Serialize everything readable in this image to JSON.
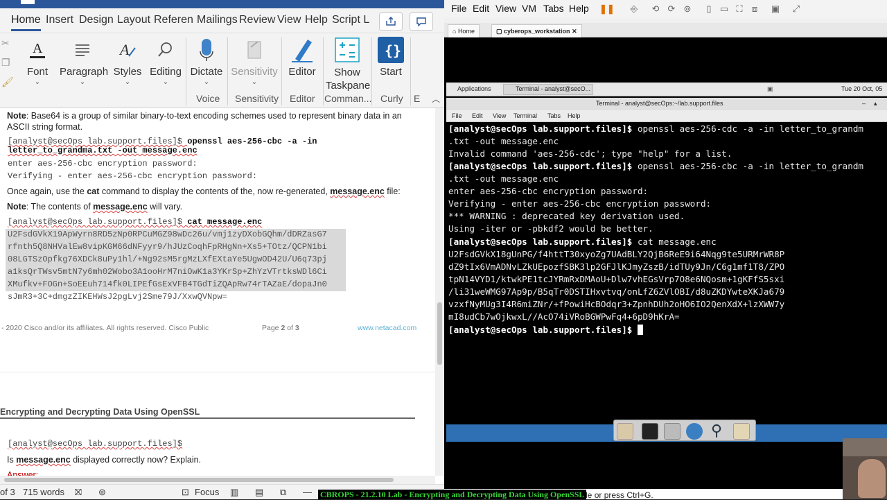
{
  "word": {
    "tabs": [
      "Home",
      "Insert",
      "Design",
      "Layout",
      "Referenc",
      "Mailings",
      "Review",
      "View",
      "Help",
      "Script La"
    ],
    "ribbon": {
      "groups": [
        {
          "label": "Font",
          "group": ""
        },
        {
          "label": "Paragraph",
          "group": ""
        },
        {
          "label": "Styles",
          "group": ""
        },
        {
          "label": "Editing",
          "group": ""
        },
        {
          "label": "Dictate",
          "group": "Voice"
        },
        {
          "label": "Sensitivity",
          "group": "Sensitivity"
        },
        {
          "label": "Editor",
          "group": "Editor"
        },
        {
          "label": "Show\nTaskpane",
          "group": "Comman..."
        },
        {
          "label": "Start",
          "group": "Curly"
        },
        {
          "label": "",
          "group": "E"
        }
      ]
    },
    "doc": {
      "note1_label": "Note",
      "note1_text": ": Base64 is a group of similar binary-to-text encoding schemes used to represent binary data in an",
      "note1_text2": "ASCII string format.",
      "cmd1_prompt": "[analyst@secOps lab.support.files]$ ",
      "cmd1_a": "openssl aes-256-cbc -a -in",
      "cmd1_b": "letter_to_grandma.txt -out message.enc",
      "out1": "enter aes-256-cbc encryption password:",
      "out2": "Verifying - enter aes-256-cbc encryption password:",
      "once_a": "Once again, use the ",
      "once_cat": "cat",
      "once_b": " command to display the contents of the, now re-generated, ",
      "once_file": "message.enc",
      "once_c": " file:",
      "note2_label": "Note",
      "note2_a": ": The contents of ",
      "note2_file": "message.enc",
      "note2_b": " will vary.",
      "cmd2_prompt": "[analyst@secOps lab.support.files]$ ",
      "cmd2": "cat message.enc",
      "b64": [
        "U2FsdGVkX19ApWyrn8RD5zNp0RPCuMGZ98wDc26u/vmj1zyDXobGQhm/dDRZasG7",
        "rfnth5Q8NHValEw8vipKGM66dNFyyr9/hJUzCoqhFpRHgNn+Xs5+TOtz/QCPN1bi",
        "08LGTSzOpfkg76XDCk8uPy1hl/+Ng92sM5rgMzLXfEXtaYe5UgwOD42U/U6q73pj",
        "a1ksQrTWsv5mtN7y6mh02Wobo3A1ooHrM7niOwK1a3YKrSp+ZhYzVTrtksWDl6Ci",
        "XMufkv+FOGn+SoEEuh714fk0LIPEfGsExVFB4TGdTiZQApRw74rTAZaE/dopaJn0",
        "sJmR3+3C+dmgzZIKEHWsJ2pgLvj2Sme79J/XxwQVNpw="
      ],
      "footer_left": "- 2020 Cisco and/or its affiliates. All rights reserved. Cisco Public",
      "footer_page_a": "Page ",
      "footer_page_n": "2",
      "footer_page_b": " of ",
      "footer_page_t": "3",
      "footer_link": "www.netacad.com",
      "header2": "Encrypting and Decrypting Data Using OpenSSL",
      "cmd3": "[analyst@secOps lab.support.files]$",
      "q_a": "Is ",
      "q_file": "message.enc",
      "q_b": " displayed correctly now? Explain.",
      "answer": "Answer:"
    },
    "status": {
      "page": "of 3",
      "words": "715 words",
      "focus": "Focus"
    }
  },
  "vm": {
    "menu": [
      "File",
      "Edit",
      "View",
      "VM",
      "Tabs",
      "Help"
    ],
    "tabs": [
      "Home",
      "cyberops_workstation"
    ],
    "panel": {
      "apps": "Applications",
      "terminal_btn": "Terminal - analyst@secO...",
      "clock": "Tue 20 Oct, 05"
    },
    "term_title": "Terminal - analyst@secOps:~/lab.support.files",
    "term_menu": [
      "File",
      "Edit",
      "View",
      "Terminal",
      "Tabs",
      "Help"
    ],
    "lines": [
      {
        "p": "[analyst@secOps lab.support.files]$ ",
        "c": "openssl aes-256-cdc -a -in letter_to_grandm"
      },
      {
        "p": "",
        "c": ".txt -out message.enc"
      },
      {
        "p": "",
        "c": "Invalid command 'aes-256-cdc'; type \"help\" for a list."
      },
      {
        "p": "[analyst@secOps lab.support.files]$ ",
        "c": "openssl aes-256-cbc -a -in letter_to_grandm"
      },
      {
        "p": "",
        "c": ".txt -out message.enc"
      },
      {
        "p": "",
        "c": "enter aes-256-cbc encryption password:"
      },
      {
        "p": "",
        "c": "Verifying - enter aes-256-cbc encryption password:"
      },
      {
        "p": "",
        "c": "*** WARNING : deprecated key derivation used."
      },
      {
        "p": "",
        "c": "Using -iter or -pbkdf2 would be better."
      },
      {
        "p": "[analyst@secOps lab.support.files]$ ",
        "c": "cat message.enc"
      },
      {
        "p": "",
        "c": "U2FsdGVkX18gUnPG/f4httT30xyoZg7UAdBLY2QjB6ReE9i64Nqg9te5URMrWR8P"
      },
      {
        "p": "",
        "c": "dZ9tIx6VmADNvLZkUEpozfSBK3lp2GFJlKJmyZszB/idTUy9Jn/C6g1mf1T8/ZPO"
      },
      {
        "p": "",
        "c": "tpN14VYD1/ktwkPE1tcJYRmRxDMAoU+Dlw7vhEGsVrp7O8e6NQosm+1gKFfS5sxi"
      },
      {
        "p": "",
        "c": "/li31weWMG97Ap9p/B5qTr0DSTIHxvtvq/onLfZ6ZVlOBI/d8uZKDYwteXKJa679"
      },
      {
        "p": "",
        "c": "vzxfNyMUg3I4R6miZNr/+fPowiHcBOdqr3+ZpnhDUh2oHO6IO2QenXdX+lzXWW7y"
      },
      {
        "p": "",
        "c": "mI8udCb7wOjkwxL//AcO74iVRoBGWPwFq4+6pD9hKrA="
      },
      {
        "p": "[analyst@secOps lab.support.files]$ ",
        "c": ""
      }
    ],
    "bottom_hint": "inside or press Ctrl+G."
  },
  "caption": "CBROPS - 21.2.10 Lab - Encrypting and Decrypting Data Using OpenSSL",
  "colors": {
    "word_blue": "#2b579a",
    "term_bg": "#000000",
    "caption_green": "#37d437"
  }
}
